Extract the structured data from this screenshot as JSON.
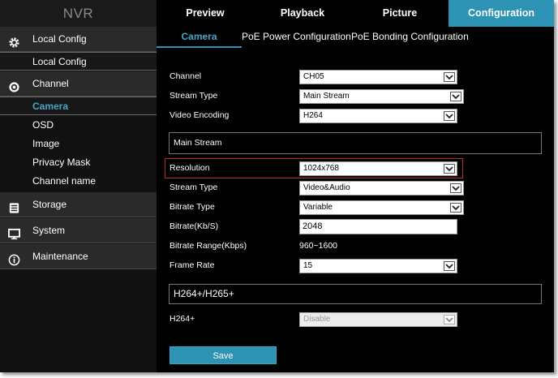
{
  "app": {
    "logo": "NVR"
  },
  "topnav": {
    "items": [
      {
        "label": "Preview"
      },
      {
        "label": "Playback"
      },
      {
        "label": "Picture"
      },
      {
        "label": "Configuration"
      }
    ]
  },
  "sidebar": {
    "local_config": {
      "label": "Local Config",
      "icon": "gear-icon"
    },
    "local_config_item": "Local Config",
    "channel": {
      "label": "Channel",
      "icon": "camera-icon"
    },
    "channel_items": [
      "Camera",
      "OSD",
      "Image",
      "Privacy Mask",
      "Channel name"
    ],
    "storage": {
      "label": "Storage",
      "icon": "storage-icon"
    },
    "system": {
      "label": "System",
      "icon": "monitor-icon"
    },
    "maintenance": {
      "label": "Maintenance",
      "icon": "info-icon"
    }
  },
  "subtabs": [
    "Camera",
    "PoE Power Configuration",
    "PoE Bonding Configuration"
  ],
  "form": {
    "channel": {
      "label": "Channel",
      "value": "CH05"
    },
    "stream_type_top": {
      "label": "Stream Type",
      "value": "Main Stream"
    },
    "video_encoding": {
      "label": "Video Encoding",
      "value": "H264"
    },
    "main_stream_section": "Main Stream",
    "resolution": {
      "label": "Resolution",
      "value": "1024x768"
    },
    "stream_type": {
      "label": "Stream Type",
      "value": "Video&Audio"
    },
    "bitrate_type": {
      "label": "Bitrate Type",
      "value": "Variable"
    },
    "bitrate": {
      "label": "Bitrate(Kb/S)",
      "value": "2048"
    },
    "bitrate_range": {
      "label": "Bitrate Range(Kbps)",
      "value": "960~1600"
    },
    "frame_rate": {
      "label": "Frame Rate",
      "value": "15"
    },
    "h264_section": "H264+/H265+",
    "h264plus": {
      "label": "H264+",
      "value": "Disable"
    }
  },
  "save_label": "Save",
  "colors": {
    "accent": "#2d93b4",
    "highlight_border": "#c0262b"
  }
}
